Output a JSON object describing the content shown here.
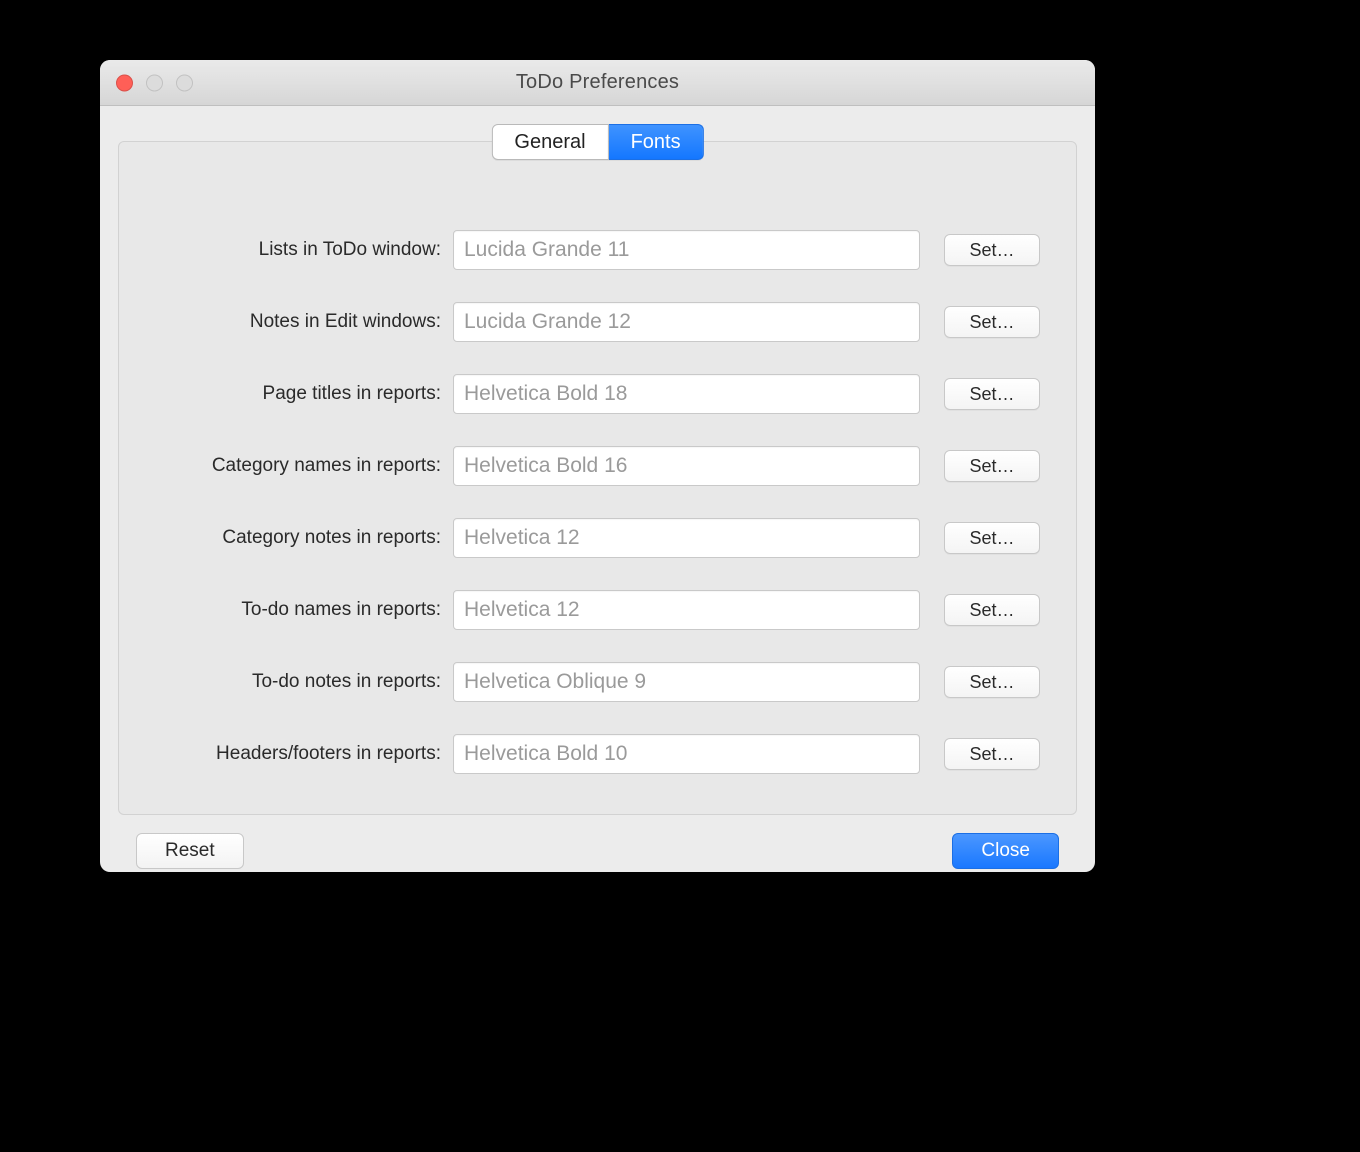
{
  "window": {
    "title": "ToDo Preferences"
  },
  "tabs": {
    "general": "General",
    "fonts": "Fonts",
    "active": "fonts"
  },
  "rows": [
    {
      "key": "lists",
      "label": "Lists in ToDo window:",
      "value": "Lucida Grande 11",
      "set": "Set…"
    },
    {
      "key": "notes",
      "label": "Notes in Edit windows:",
      "value": "Lucida Grande 12",
      "set": "Set…"
    },
    {
      "key": "page-titles",
      "label": "Page titles in reports:",
      "value": "Helvetica Bold 18",
      "set": "Set…"
    },
    {
      "key": "category-names",
      "label": "Category names in reports:",
      "value": "Helvetica Bold 16",
      "set": "Set…"
    },
    {
      "key": "category-notes",
      "label": "Category notes in reports:",
      "value": "Helvetica 12",
      "set": "Set…"
    },
    {
      "key": "todo-names",
      "label": "To-do names in reports:",
      "value": "Helvetica 12",
      "set": "Set…"
    },
    {
      "key": "todo-notes",
      "label": "To-do notes in reports:",
      "value": "Helvetica Oblique 9",
      "set": "Set…"
    },
    {
      "key": "headers",
      "label": "Headers/footers in reports:",
      "value": "Helvetica Bold 10",
      "set": "Set…"
    }
  ],
  "footer": {
    "reset": "Reset",
    "close": "Close"
  }
}
